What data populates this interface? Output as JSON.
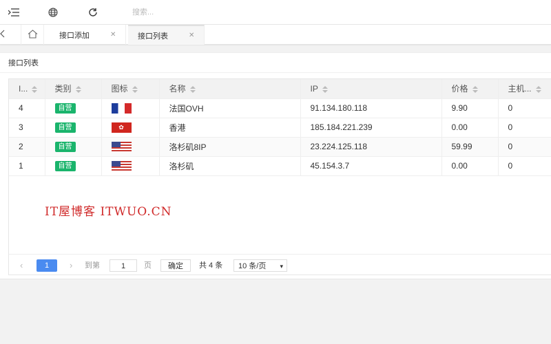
{
  "header": {
    "search_placeholder": "搜索..."
  },
  "tabs": [
    {
      "label": "接口添加"
    },
    {
      "label": "接口列表"
    }
  ],
  "card": {
    "title": "接口列表"
  },
  "table": {
    "columns": [
      "I...",
      "类别",
      "图标",
      "名称",
      "IP",
      "价格",
      "主机..."
    ],
    "rows": [
      {
        "id": "4",
        "category": "自营",
        "flag": "fr",
        "name": "法国OVH",
        "ip": "91.134.180.118",
        "price": "9.90",
        "host": "0"
      },
      {
        "id": "3",
        "category": "自营",
        "flag": "hk",
        "name": "香港",
        "ip": "185.184.221.239",
        "price": "0.00",
        "host": "0"
      },
      {
        "id": "2",
        "category": "自营",
        "flag": "us",
        "name": "洛杉矶8IP",
        "ip": "23.224.125.118",
        "price": "59.99",
        "host": "0"
      },
      {
        "id": "1",
        "category": "自营",
        "flag": "us",
        "name": "洛杉矶",
        "ip": "45.154.3.7",
        "price": "0.00",
        "host": "0"
      }
    ]
  },
  "watermark": "IT屋博客 ITWUO.CN",
  "pagination": {
    "current_page": "1",
    "goto_label": "到第",
    "goto_value": "1",
    "page_suffix": "页",
    "confirm_label": "确定",
    "total_label": "共 4 条",
    "page_size": "10 条/页"
  },
  "colors": {
    "badge": "#1ab46c",
    "accent": "#4a8bf0",
    "watermark": "#d02a2a"
  },
  "icons": [
    "menu-fold-icon",
    "globe-icon",
    "refresh-icon",
    "double-chevron-left-icon",
    "home-icon",
    "close-icon",
    "chevron-left-icon",
    "chevron-right-icon",
    "chevron-down-icon"
  ]
}
